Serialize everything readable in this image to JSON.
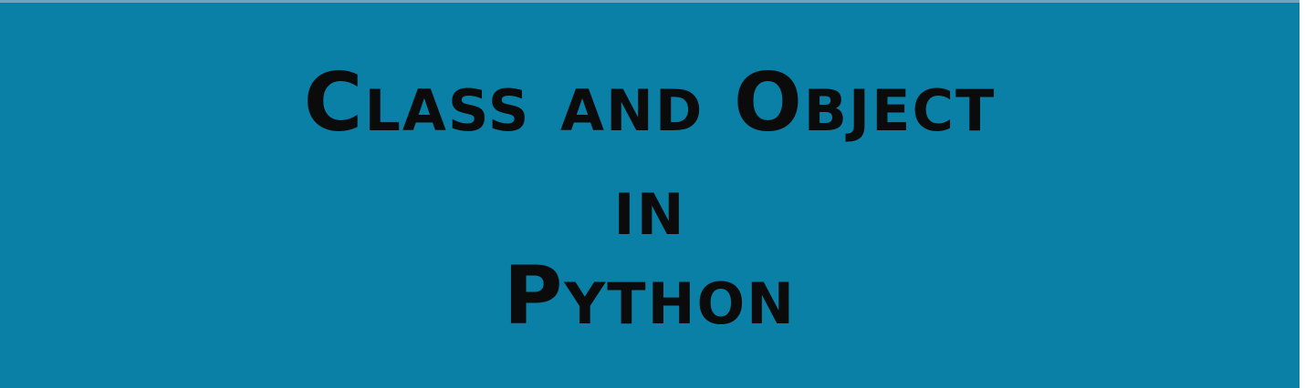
{
  "slide": {
    "line1": "Class and Object",
    "line2": "in",
    "line3": "Python"
  }
}
